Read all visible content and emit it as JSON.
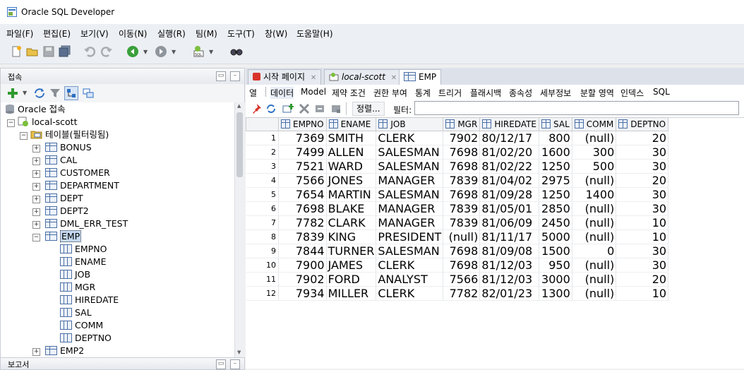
{
  "app": {
    "title": "Oracle SQL Developer"
  },
  "menu": [
    "파일(F)",
    "편집(E)",
    "보기(V)",
    "이동(N)",
    "실행(R)",
    "팀(M)",
    "도구(T)",
    "창(W)",
    "도움말(H)"
  ],
  "toolbar": {
    "icons": [
      "new-icon",
      "open-icon",
      "save-icon",
      "save-all-icon",
      "undo-icon",
      "redo-icon",
      "back-icon",
      "forward-icon",
      "sql-worksheet-icon",
      "find-db-object-icon"
    ]
  },
  "connections_panel": {
    "title": "접속",
    "bottom_title": "보고서",
    "tree": {
      "root": "Oracle 접속",
      "connection": "local-scott",
      "tables_node": "테이블(필터링됨)",
      "tables": [
        "BONUS",
        "CAL",
        "CUSTOMER",
        "DEPARTMENT",
        "DEPT",
        "DEPT2",
        "DML_ERR_TEST",
        "EMP",
        "EMP2"
      ],
      "selected_table": "EMP",
      "emp_columns": [
        "EMPNO",
        "ENAME",
        "JOB",
        "MGR",
        "HIREDATE",
        "SAL",
        "COMM",
        "DEPTNO"
      ]
    }
  },
  "editor": {
    "tabs": [
      {
        "label": "시작 페이지"
      },
      {
        "label": "local-scott"
      },
      {
        "label": "EMP"
      }
    ],
    "subtabs": [
      "열",
      "데이터",
      "Model",
      "제약 조건",
      "권한 부여",
      "통계",
      "트리거",
      "플래시백",
      "종속성",
      "세부정보",
      "분할 영역",
      "인덱스",
      "SQL"
    ],
    "active_subtab": "데이터",
    "grid_toolbar": {
      "sort_label": "정렬...",
      "filter_label": "필터:",
      "filter_value": ""
    },
    "grid": {
      "columns": [
        "EMPNO",
        "ENAME",
        "JOB",
        "MGR",
        "HIREDATE",
        "SAL",
        "COMM",
        "DEPTNO"
      ],
      "rows": [
        [
          "1",
          "7369",
          "SMITH",
          "CLERK",
          "7902",
          "80/12/17",
          "800",
          "(null)",
          "20"
        ],
        [
          "2",
          "7499",
          "ALLEN",
          "SALESMAN",
          "7698",
          "81/02/20",
          "1600",
          "300",
          "30"
        ],
        [
          "3",
          "7521",
          "WARD",
          "SALESMAN",
          "7698",
          "81/02/22",
          "1250",
          "500",
          "30"
        ],
        [
          "4",
          "7566",
          "JONES",
          "MANAGER",
          "7839",
          "81/04/02",
          "2975",
          "(null)",
          "20"
        ],
        [
          "5",
          "7654",
          "MARTIN",
          "SALESMAN",
          "7698",
          "81/09/28",
          "1250",
          "1400",
          "30"
        ],
        [
          "6",
          "7698",
          "BLAKE",
          "MANAGER",
          "7839",
          "81/05/01",
          "2850",
          "(null)",
          "30"
        ],
        [
          "7",
          "7782",
          "CLARK",
          "MANAGER",
          "7839",
          "81/06/09",
          "2450",
          "(null)",
          "10"
        ],
        [
          "8",
          "7839",
          "KING",
          "PRESIDENT",
          "(null)",
          "81/11/17",
          "5000",
          "(null)",
          "10"
        ],
        [
          "9",
          "7844",
          "TURNER",
          "SALESMAN",
          "7698",
          "81/09/08",
          "1500",
          "0",
          "30"
        ],
        [
          "10",
          "7900",
          "JAMES",
          "CLERK",
          "7698",
          "81/12/03",
          "950",
          "(null)",
          "30"
        ],
        [
          "11",
          "7902",
          "FORD",
          "ANALYST",
          "7566",
          "81/12/03",
          "3000",
          "(null)",
          "20"
        ],
        [
          "12",
          "7934",
          "MILLER",
          "CLERK",
          "7782",
          "82/01/23",
          "1300",
          "(null)",
          "10"
        ]
      ]
    }
  },
  "colors": {
    "accent_red": "#d9342b",
    "table_blue": "#4a6fa5",
    "selection": "#c5d9f1"
  }
}
